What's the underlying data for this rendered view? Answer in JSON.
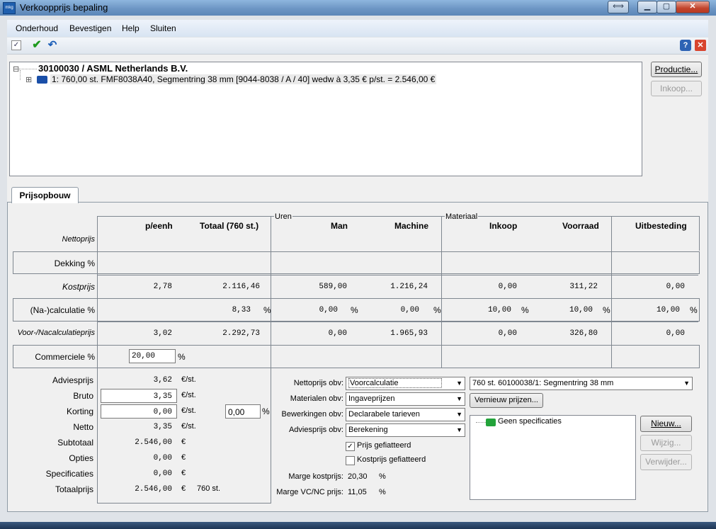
{
  "window": {
    "title": "Verkoopprijs bepaling",
    "app_icon": "mkg"
  },
  "menu": [
    "Onderhoud",
    "Bevestigen",
    "Help",
    "Sluiten"
  ],
  "tree": {
    "root": "30100030 / ASML Netherlands B.V.",
    "child": "1: 760,00 st. FMF8038A40, Segmentring 38 mm [9044-8038 / A / 40] wedw à 3,35 € p/st. = 2.546,00 €",
    "expand_root": "⊟",
    "expand_child": "⊞"
  },
  "side_buttons": {
    "productie": "Productie...",
    "inkoop": "Inkoop..."
  },
  "tab": "Prijsopbouw",
  "groups": {
    "uren": "Uren",
    "materiaal": "Materiaal"
  },
  "headers": {
    "p_eenh": "p/eenh",
    "totaal": "Totaal (760 st.)",
    "man": "Man",
    "machine": "Machine",
    "inkoop": "Inkoop",
    "voorraad": "Voorraad",
    "uitbesteding": "Uitbesteding"
  },
  "rows": {
    "nettoprijs": "Nettoprijs",
    "dekking": "Dekking %",
    "kostprijs": "Kostprijs",
    "nacalc": "(Na-)calculatie %",
    "voorna": "Voor-/Nacalculatieprijs",
    "commercieel": "Commerciele %"
  },
  "kostprijs": {
    "p_eenh": "2,78",
    "totaal": "2.116,46",
    "man": "589,00",
    "machine": "1.216,24",
    "inkoop": "0,00",
    "voorraad": "311,22",
    "uitbesteding": "0,00"
  },
  "nacalc": {
    "totaal": "8,33",
    "man": "0,00",
    "machine": "0,00",
    "inkoop": "10,00",
    "voorraad": "10,00",
    "uitbesteding": "10,00",
    "pct": "%"
  },
  "voorna": {
    "p_eenh": "3,02",
    "totaal": "2.292,73",
    "man": "0,00",
    "machine": "1.965,93",
    "inkoop": "0,00",
    "voorraad": "326,80",
    "uitbesteding": "0,00"
  },
  "commercieel": {
    "value": "20,00",
    "pct": "%"
  },
  "summary": {
    "adviesprijs": {
      "label": "Adviesprijs",
      "value": "3,62",
      "unit": "€/st."
    },
    "bruto": {
      "label": "Bruto",
      "value": "3,35",
      "unit": "€/st."
    },
    "korting": {
      "label": "Korting",
      "value": "0,00",
      "unit": "€/st.",
      "pct_value": "0,00",
      "pct": "%"
    },
    "netto": {
      "label": "Netto",
      "value": "3,35",
      "unit": "€/st."
    },
    "subtotaal": {
      "label": "Subtotaal",
      "value": "2.546,00",
      "unit": "€"
    },
    "opties": {
      "label": "Opties",
      "value": "0,00",
      "unit": "€"
    },
    "specificaties": {
      "label": "Specificaties",
      "value": "0,00",
      "unit": "€"
    },
    "totaalprijs": {
      "label": "Totaalprijs",
      "value": "2.546,00",
      "unit": "€",
      "qty": "760 st."
    }
  },
  "options": {
    "nettoprijs_obv": {
      "label": "Nettoprijs obv:",
      "value": "Voorcalculatie"
    },
    "materialen_obv": {
      "label": "Materialen obv:",
      "value": "Ingaveprijzen"
    },
    "bewerkingen_obv": {
      "label": "Bewerkingen obv:",
      "value": "Declarabele tarieven"
    },
    "adviesprijs_obv": {
      "label": "Adviesprijs obv:",
      "value": "Berekening"
    },
    "prijs_gefiatteerd": {
      "label": "Prijs gefiatteerd",
      "checked": true,
      "mark": "✓"
    },
    "kostprijs_gefiatteerd": {
      "label": "Kostprijs gefiatteerd",
      "checked": false
    },
    "marge_kostprijs": {
      "label": "Marge kostprijs:",
      "value": "20,30",
      "pct": "%"
    },
    "marge_vcnc": {
      "label": "Marge VC/NC prijs:",
      "value": "11,05",
      "pct": "%"
    }
  },
  "spec": {
    "combo": "760 st. 60100038/1: Segmentring 38 mm",
    "vernieuw": "Vernieuw prijzen...",
    "empty": "Geen specificaties",
    "nieuw": "Nieuw...",
    "wijzig": "Wijzig...",
    "verwijder": "Verwijder..."
  }
}
